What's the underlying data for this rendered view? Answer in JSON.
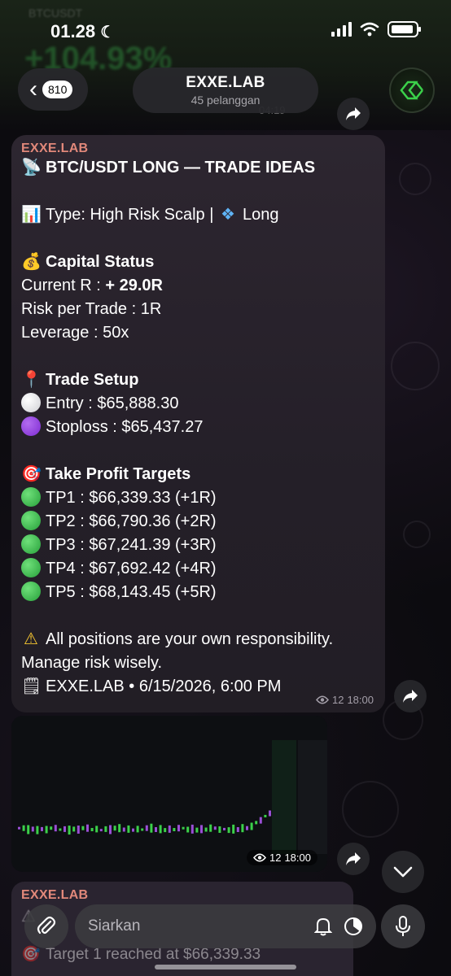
{
  "status": {
    "time": "01.28"
  },
  "header": {
    "back_badge": "810",
    "channel_name": "EXXE.LAB",
    "subscribers": "45 pelanggan"
  },
  "message": {
    "sender": "EXXE.LAB",
    "title": "BTC/USDT LONG — TRADE IDEAS",
    "type_line": "Type: High Risk Scalp | ",
    "type_direction": "Long",
    "capital_heading": "Capital Status",
    "current_r_label": "Current R : ",
    "current_r_value": "+ 29.0R",
    "risk_line": "Risk per Trade : 1R",
    "leverage_line": "Leverage : 50x",
    "setup_heading": "Trade Setup",
    "entry_line": "Entry : $65,888.30",
    "stoploss_line": "Stoploss : $65,437.27",
    "tp_heading": "Take Profit Targets",
    "targets": [
      "TP1 : $66,339.33 (+1R)",
      "TP2 : $66,790.36 (+2R)",
      "TP3 : $67,241.39 (+3R)",
      "TP4 : $67,692.42 (+4R)",
      "TP5 : $68,143.45 (+5R)"
    ],
    "warning_line1": "All positions are your own responsibility.",
    "warning_line2": "Manage risk wisely.",
    "footer": "EXXE.LAB • 6/15/2026, 6:00 PM",
    "views": "12",
    "time": "18:00"
  },
  "image_message": {
    "views": "12",
    "time": "18:00"
  },
  "next_message": {
    "sender": "EXXE.LAB",
    "line2": "Target 1 reached at $66,339.33"
  },
  "compose": {
    "placeholder": "Siarkan"
  },
  "colors": {
    "accent": "#e1887a",
    "bubble": "#2d2630",
    "green": "#3bd14a"
  }
}
